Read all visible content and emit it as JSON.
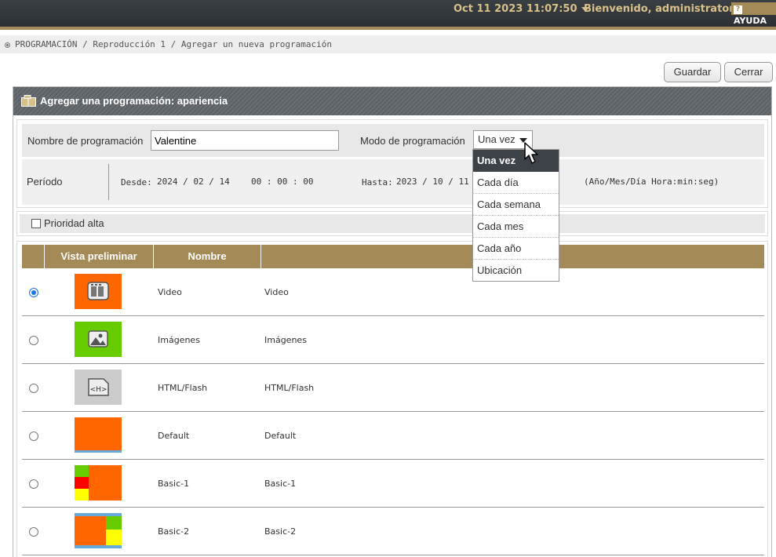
{
  "topbar": {
    "datetime": "Oct 11 2023 11:07:50",
    "welcome": "Bienvenido, administrator",
    "help": "AYUDA"
  },
  "breadcrumb": "PROGRAMACIÓN / Reproducción 1 / Agregar un nueva programación",
  "buttons": {
    "save": "Guardar",
    "close": "Cerrar"
  },
  "panel": {
    "title": "Agregar una programación: apariencia"
  },
  "form": {
    "name_label": "Nombre de programación",
    "name_value": "Valentine",
    "mode_label": "Modo de programación",
    "mode_value": "Una vez",
    "period_label": "Período",
    "from_label": "Desde:",
    "from_date": "2024 / 02 / 14",
    "from_time": "00 : 00 : 00",
    "to_label": "Hasta:",
    "to_date": "2023 / 10 / 11",
    "format_hint": "(Año/Mes/Día Hora:min:seg)",
    "priority_label": "Prioridad alta"
  },
  "dropdown": {
    "options": [
      "Una vez",
      "Cada día",
      "Cada semana",
      "Cada mes",
      "Cada año",
      "Ubicación"
    ]
  },
  "table": {
    "headers": [
      "Vista preliminar",
      "Nombre"
    ],
    "rows": [
      {
        "type": "Video",
        "name": "Video",
        "selected": true,
        "thumb": "video-icon",
        "color": "#ff6600"
      },
      {
        "type": "Imágenes",
        "name": "Imágenes",
        "selected": false,
        "thumb": "image-icon",
        "color": "#66cc00"
      },
      {
        "type": "HTML/Flash",
        "name": "HTML/Flash",
        "selected": false,
        "thumb": "html-icon",
        "color": "#cccccc"
      },
      {
        "type": "Default",
        "name": "Default",
        "selected": false,
        "thumb": "layout-default"
      },
      {
        "type": "Basic-1",
        "name": "Basic-1",
        "selected": false,
        "thumb": "layout-basic-1"
      },
      {
        "type": "Basic-2",
        "name": "Basic-2",
        "selected": false,
        "thumb": "layout-basic-2"
      }
    ]
  },
  "colors": {
    "accent": "#a38a56",
    "dark": "#2c3034",
    "orange": "#ff6600",
    "green": "#66cc00",
    "yellow": "#ffff00",
    "red": "#ff0000",
    "blue": "#66aadd"
  }
}
